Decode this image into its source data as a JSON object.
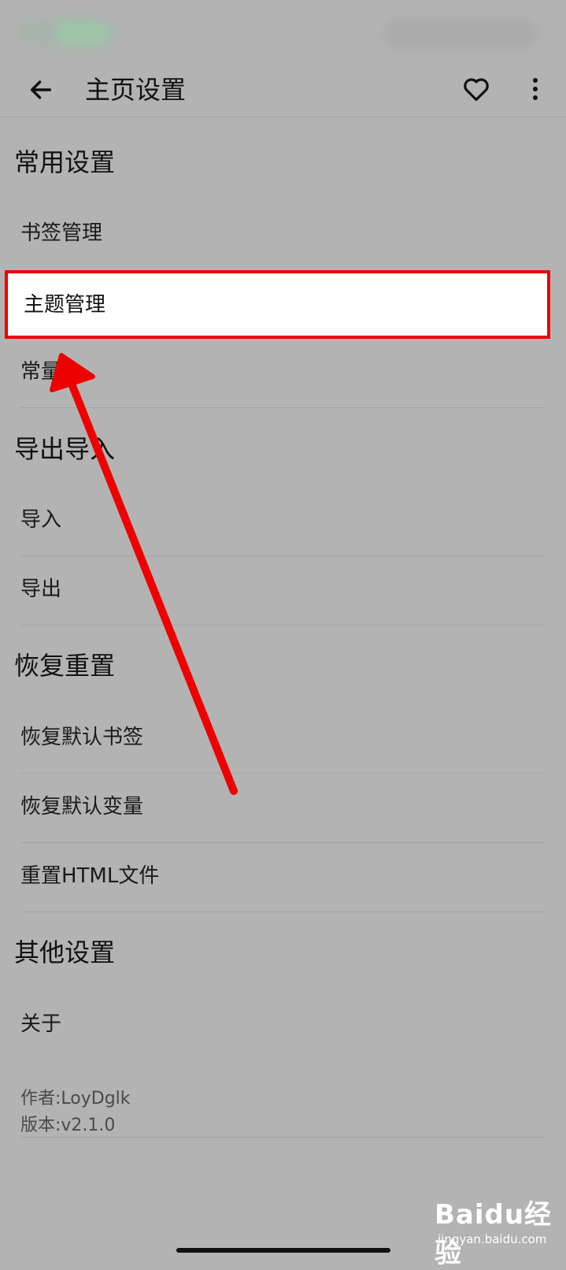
{
  "appbar": {
    "title": "主页设置",
    "back_icon": "arrow-left-icon",
    "favorite_icon": "heart-outline-icon",
    "more_icon": "more-vertical-icon"
  },
  "sections": {
    "common": {
      "header": "常用设置",
      "bookmark": "书签管理",
      "theme": "主题管理",
      "variable": "常量"
    },
    "export_import": {
      "header": "导出导入",
      "import": "导入",
      "export": "导出"
    },
    "reset": {
      "header": "恢复重置",
      "restore_bookmarks": "恢复默认书签",
      "restore_variables": "恢复默认变量",
      "reset_html": "重置HTML文件"
    },
    "other": {
      "header": "其他设置",
      "about": "关于",
      "author": "作者:LoyDglk",
      "version": "版本:v2.1.0"
    }
  },
  "annotation": {
    "highlight_color": "#ee0000"
  },
  "watermark": {
    "logo": "Baidu经验",
    "site": "jingyan.baidu.com"
  }
}
